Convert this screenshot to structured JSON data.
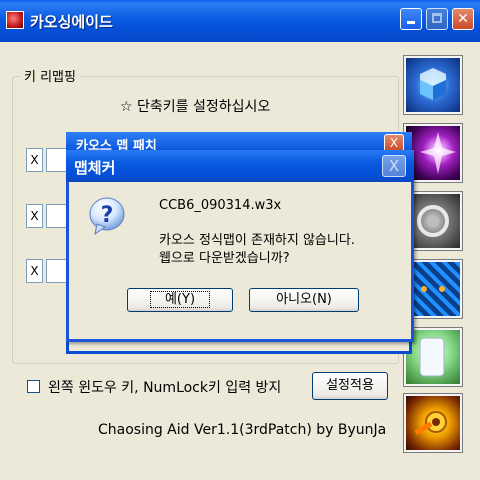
{
  "window": {
    "title": "카오싱에이드",
    "controls": {
      "minimize_icon": "minimize-icon",
      "maximize_icon": "maximize-icon",
      "close_icon": "close-icon"
    }
  },
  "keymap": {
    "group_label": "키 리맵핑",
    "instruction": "☆ 단축키를 설정하십시오",
    "rows": [
      {
        "remove_label": "X",
        "value": ""
      },
      {
        "remove_label": "X",
        "value": ""
      },
      {
        "remove_label": "X",
        "value": ""
      }
    ]
  },
  "options": {
    "checkbox_label": "왼쪽 윈도우 키, NumLock키 입력 방지",
    "checked": false,
    "apply_label": "설정적용"
  },
  "credit": "Chaosing Aid Ver1.1(3rdPatch) by ByunJa",
  "background_dialog": {
    "title": "카오스 맵 패치",
    "close_label": "X"
  },
  "dialog": {
    "title": "맵체커",
    "close_label": "X",
    "icon": "question-icon",
    "filename": "CCB6_090314.w3x",
    "message_line1": "카오스 정식맵이 존재하지 않습니다.",
    "message_line2": "웹으로 다운받겠습니까?",
    "yes_label": "예(Y)",
    "no_label": "아니오(N)"
  },
  "icon_tiles": [
    "blue-logo-icon",
    "purple-flare-icon",
    "silver-orb-icon",
    "blue-mesh-icon",
    "scroll-icon",
    "golden-gear-icon"
  ],
  "colors": {
    "titlebar_blue": "#0550d8",
    "window_bg": "#ece9d8",
    "close_red": "#c94a2a"
  }
}
